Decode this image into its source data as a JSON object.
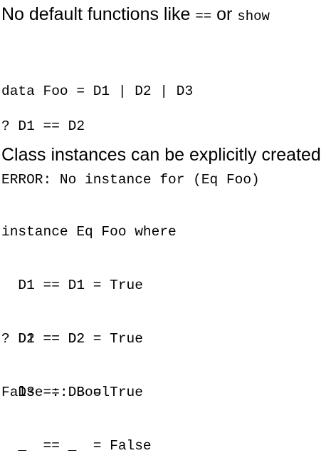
{
  "heading1": {
    "text": "No default functions like ",
    "code1": "==",
    "mid": " or ",
    "code2": "show"
  },
  "block1": [
    "data Foo = D1 | D2 | D3"
  ],
  "block2": [
    "? D1 == D2",
    "ERROR: No instance for (Eq Foo)"
  ],
  "heading2": {
    "text": "Class instances can be explicitly created"
  },
  "block3": [
    "instance Eq Foo where",
    "  D1 == D1 = True",
    "  D2 == D2 = True",
    "  D3 == D3 = True",
    "  _  == _  = False"
  ],
  "block4": [
    "? D1 == D2",
    "False :: Bool"
  ]
}
